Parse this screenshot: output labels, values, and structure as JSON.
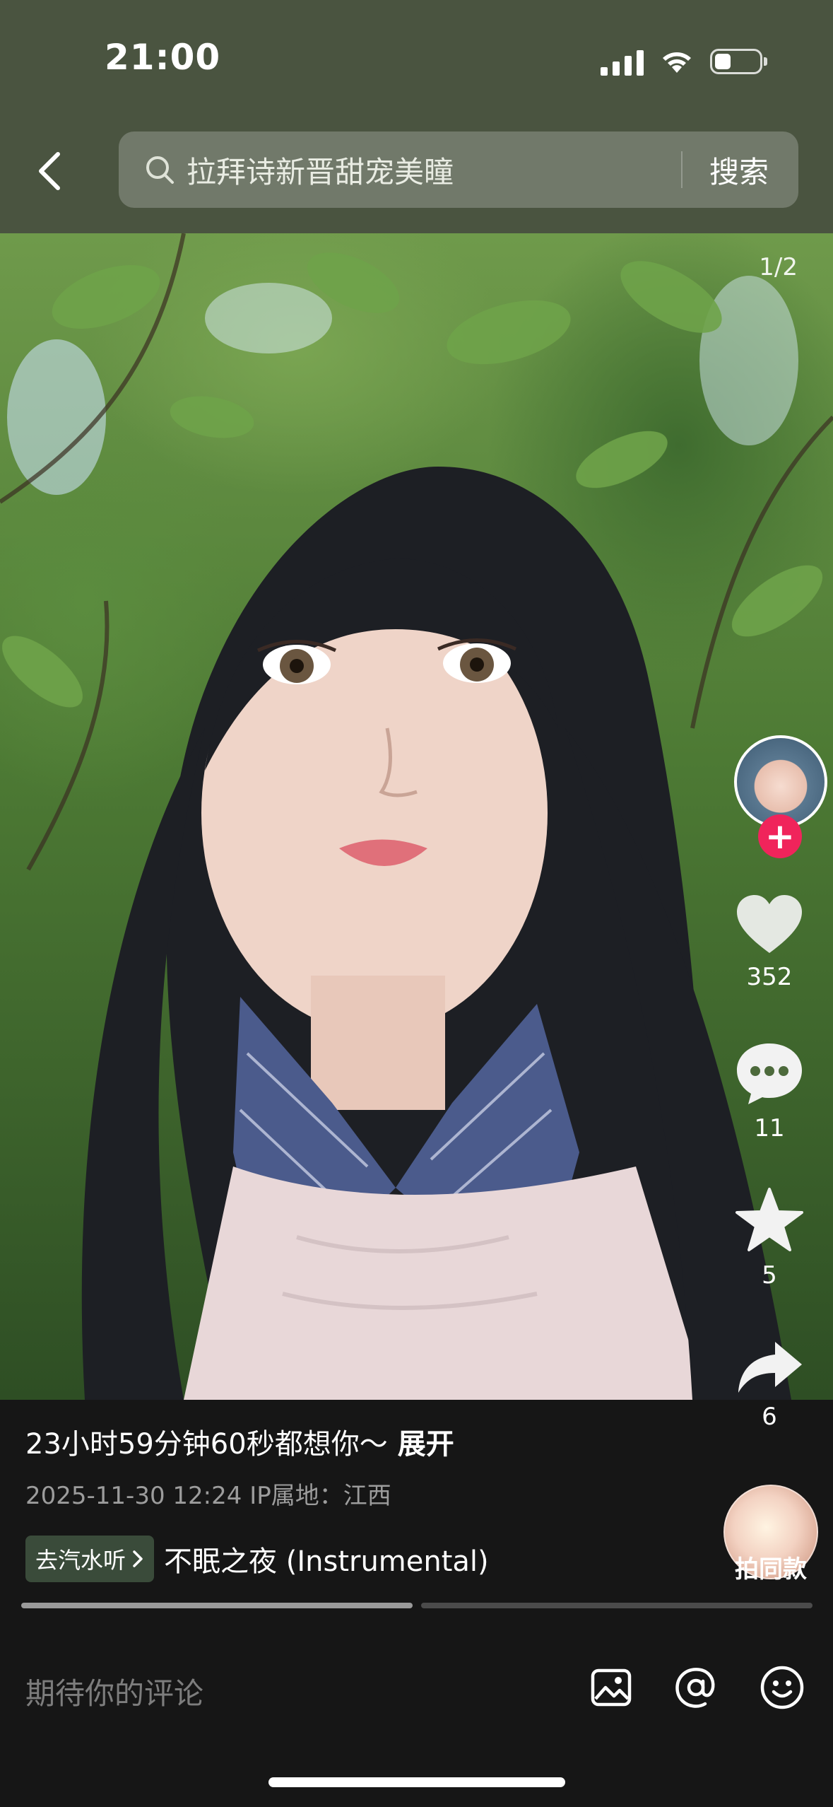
{
  "status_bar": {
    "time": "21:00"
  },
  "search": {
    "query": "拉拜诗新晋甜宠美瞳",
    "button_label": "搜索"
  },
  "post": {
    "page_indicator": "1/2"
  },
  "actions": {
    "like_count": "352",
    "comment_count": "11",
    "favorite_count": "5",
    "share_count": "6",
    "same_style_label": "拍同款"
  },
  "caption": {
    "text": "23小时59分钟60秒都想你～",
    "expand_label": "展开",
    "meta": "2025-11-30 12:24  IP属地：江西"
  },
  "music": {
    "badge_label": "去汽水听",
    "title": "不眠之夜 (Instrumental)"
  },
  "progress": {
    "total_pages": 2,
    "current_page": 1
  },
  "comment_bar": {
    "placeholder": "期待你的评论"
  },
  "colors": {
    "header_bg": "#4a5440",
    "follow_plus": "#f0245b",
    "background": "#161616"
  }
}
